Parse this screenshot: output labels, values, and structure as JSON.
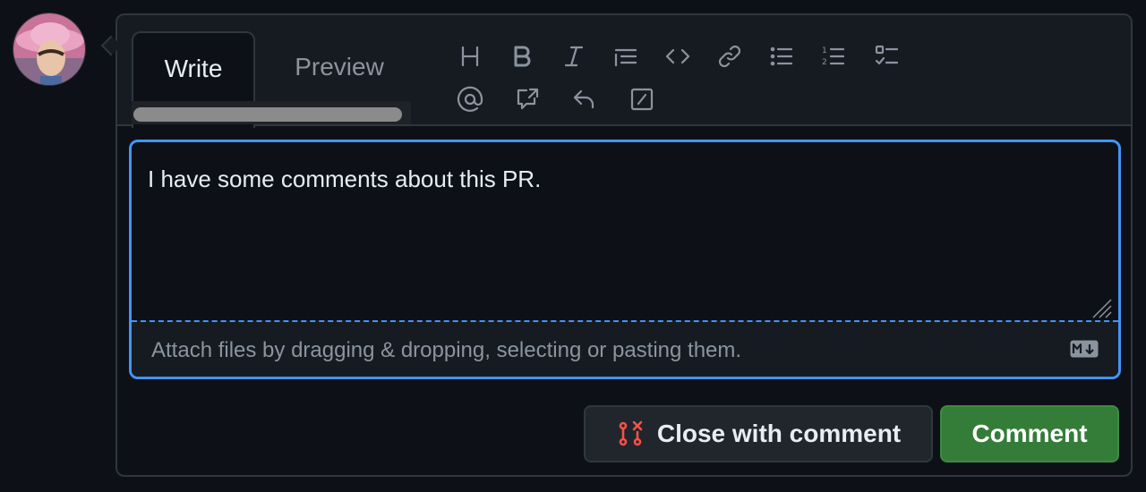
{
  "tabs": {
    "write_label": "Write",
    "preview_label": "Preview"
  },
  "toolbar": {
    "buttons": [
      "heading-icon",
      "bold-icon",
      "italic-icon",
      "quote-icon",
      "code-icon",
      "link-icon",
      "bulleted-list-icon",
      "numbered-list-icon",
      "task-list-icon",
      "mention-icon",
      "cross-reference-icon",
      "reply-icon",
      "slash-commands-icon"
    ]
  },
  "editor": {
    "value": "I have some comments about this PR.",
    "attach_text": "Attach files by dragging & dropping, selecting or pasting them."
  },
  "actions": {
    "close_label": "Close with comment",
    "comment_label": "Comment"
  },
  "colors": {
    "background": "#0d1117",
    "accent": "#4493f8",
    "primary_button": "#347d39",
    "close_icon": "#f85149"
  }
}
